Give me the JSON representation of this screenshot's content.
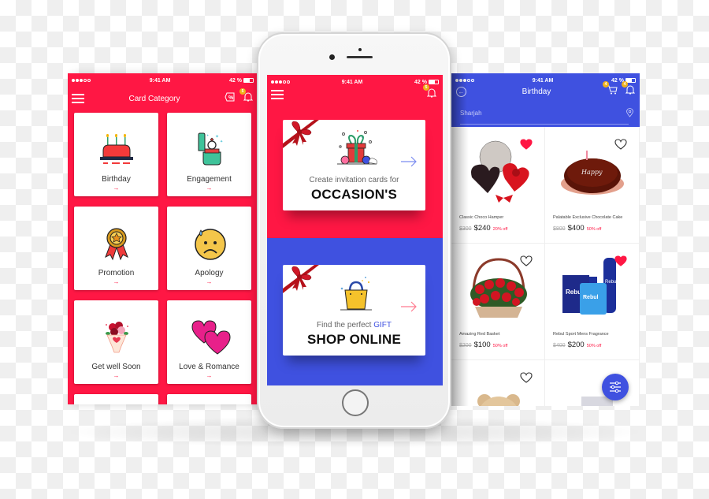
{
  "status_bar": {
    "time": "9:41 AM",
    "battery": "42 %"
  },
  "left_screen": {
    "title": "Card Category",
    "offer_icon": "offer-tag-icon",
    "notification_badge": "5",
    "arrow_glyph": "→",
    "categories": [
      {
        "label": "Birthday",
        "icon": "birthday-cake-icon"
      },
      {
        "label": "Engagement",
        "icon": "ring-box-icon"
      },
      {
        "label": "Promotion",
        "icon": "award-medal-icon"
      },
      {
        "label": "Apology",
        "icon": "sad-face-icon"
      },
      {
        "label": "Get well Soon",
        "icon": "flower-bouquet-icon"
      },
      {
        "label": "Love & Romance",
        "icon": "hearts-icon"
      }
    ],
    "colors": {
      "primary": "#ff1744"
    }
  },
  "center_screen": {
    "notification_badge": "5",
    "cards": [
      {
        "subtitle": "Create invitation cards for",
        "subtitle_accent": "",
        "title": "OCCASION'S",
        "icon": "gift-box-icon",
        "arrow_color": "#7b8cf0"
      },
      {
        "subtitle": "Find the perfect ",
        "subtitle_accent": "GIFT",
        "title": "SHOP ONLINE",
        "icon": "shopping-bag-icon",
        "arrow_color": "#ff7a8f"
      }
    ],
    "colors": {
      "top": "#ff1744",
      "bottom": "#3f51e0"
    }
  },
  "right_screen": {
    "title": "Birthday",
    "cart_badge": "4",
    "notification_badge": "4",
    "location": "Sharjah",
    "products": [
      {
        "name": "Classic Choco Hamper",
        "old_price": "$300",
        "price": "$240",
        "discount": "20% off",
        "favorited": true,
        "image": "choco-hamper"
      },
      {
        "name": "Palatable Exclusive Chocolate Cake",
        "old_price": "$800",
        "price": "$400",
        "discount": "50% off",
        "favorited": false,
        "image": "chocolate-cake"
      },
      {
        "name": "Amazing Red Basket",
        "old_price": "$200",
        "price": "$100",
        "discount": "50% off",
        "favorited": false,
        "image": "red-rose-basket"
      },
      {
        "name": "Rebul Sport Mens Fragrance",
        "old_price": "$400",
        "price": "$200",
        "discount": "50% off",
        "favorited": true,
        "image": "fragrance-set"
      },
      {
        "name": "",
        "old_price": "",
        "price": "",
        "discount": "",
        "favorited": false,
        "image": "teddy-bear"
      },
      {
        "name": "",
        "old_price": "",
        "price": "",
        "discount": "",
        "favorited": false,
        "image": "gift-hamper"
      }
    ],
    "colors": {
      "primary": "#3f51e0",
      "heart": "#ff1744"
    }
  }
}
